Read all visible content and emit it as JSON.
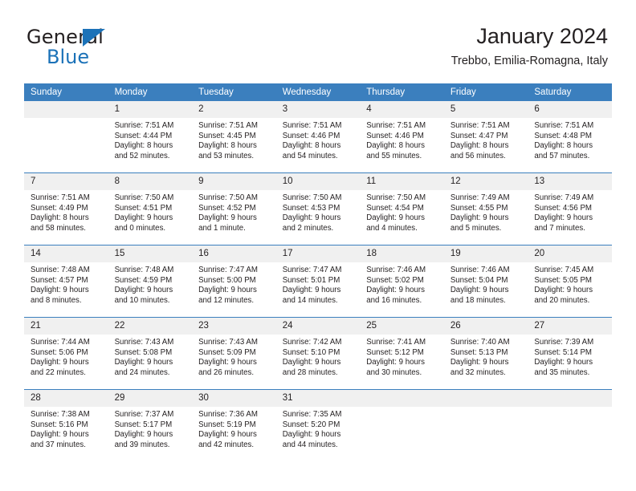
{
  "brand": {
    "name_top": "General",
    "name_bottom": "Blue",
    "accent_color": "#1b72b8"
  },
  "header": {
    "title": "January 2024",
    "subtitle": "Trebbo, Emilia-Romagna, Italy",
    "header_bg": "#3b7fbe",
    "daynum_bg": "#f0f0f0"
  },
  "weekdays": [
    "Sunday",
    "Monday",
    "Tuesday",
    "Wednesday",
    "Thursday",
    "Friday",
    "Saturday"
  ],
  "weeks": [
    [
      {
        "day": ""
      },
      {
        "day": "1",
        "sunrise": "Sunrise: 7:51 AM",
        "sunset": "Sunset: 4:44 PM",
        "daylight_1": "Daylight: 8 hours",
        "daylight_2": "and 52 minutes."
      },
      {
        "day": "2",
        "sunrise": "Sunrise: 7:51 AM",
        "sunset": "Sunset: 4:45 PM",
        "daylight_1": "Daylight: 8 hours",
        "daylight_2": "and 53 minutes."
      },
      {
        "day": "3",
        "sunrise": "Sunrise: 7:51 AM",
        "sunset": "Sunset: 4:46 PM",
        "daylight_1": "Daylight: 8 hours",
        "daylight_2": "and 54 minutes."
      },
      {
        "day": "4",
        "sunrise": "Sunrise: 7:51 AM",
        "sunset": "Sunset: 4:46 PM",
        "daylight_1": "Daylight: 8 hours",
        "daylight_2": "and 55 minutes."
      },
      {
        "day": "5",
        "sunrise": "Sunrise: 7:51 AM",
        "sunset": "Sunset: 4:47 PM",
        "daylight_1": "Daylight: 8 hours",
        "daylight_2": "and 56 minutes."
      },
      {
        "day": "6",
        "sunrise": "Sunrise: 7:51 AM",
        "sunset": "Sunset: 4:48 PM",
        "daylight_1": "Daylight: 8 hours",
        "daylight_2": "and 57 minutes."
      }
    ],
    [
      {
        "day": "7",
        "sunrise": "Sunrise: 7:51 AM",
        "sunset": "Sunset: 4:49 PM",
        "daylight_1": "Daylight: 8 hours",
        "daylight_2": "and 58 minutes."
      },
      {
        "day": "8",
        "sunrise": "Sunrise: 7:50 AM",
        "sunset": "Sunset: 4:51 PM",
        "daylight_1": "Daylight: 9 hours",
        "daylight_2": "and 0 minutes."
      },
      {
        "day": "9",
        "sunrise": "Sunrise: 7:50 AM",
        "sunset": "Sunset: 4:52 PM",
        "daylight_1": "Daylight: 9 hours",
        "daylight_2": "and 1 minute."
      },
      {
        "day": "10",
        "sunrise": "Sunrise: 7:50 AM",
        "sunset": "Sunset: 4:53 PM",
        "daylight_1": "Daylight: 9 hours",
        "daylight_2": "and 2 minutes."
      },
      {
        "day": "11",
        "sunrise": "Sunrise: 7:50 AM",
        "sunset": "Sunset: 4:54 PM",
        "daylight_1": "Daylight: 9 hours",
        "daylight_2": "and 4 minutes."
      },
      {
        "day": "12",
        "sunrise": "Sunrise: 7:49 AM",
        "sunset": "Sunset: 4:55 PM",
        "daylight_1": "Daylight: 9 hours",
        "daylight_2": "and 5 minutes."
      },
      {
        "day": "13",
        "sunrise": "Sunrise: 7:49 AM",
        "sunset": "Sunset: 4:56 PM",
        "daylight_1": "Daylight: 9 hours",
        "daylight_2": "and 7 minutes."
      }
    ],
    [
      {
        "day": "14",
        "sunrise": "Sunrise: 7:48 AM",
        "sunset": "Sunset: 4:57 PM",
        "daylight_1": "Daylight: 9 hours",
        "daylight_2": "and 8 minutes."
      },
      {
        "day": "15",
        "sunrise": "Sunrise: 7:48 AM",
        "sunset": "Sunset: 4:59 PM",
        "daylight_1": "Daylight: 9 hours",
        "daylight_2": "and 10 minutes."
      },
      {
        "day": "16",
        "sunrise": "Sunrise: 7:47 AM",
        "sunset": "Sunset: 5:00 PM",
        "daylight_1": "Daylight: 9 hours",
        "daylight_2": "and 12 minutes."
      },
      {
        "day": "17",
        "sunrise": "Sunrise: 7:47 AM",
        "sunset": "Sunset: 5:01 PM",
        "daylight_1": "Daylight: 9 hours",
        "daylight_2": "and 14 minutes."
      },
      {
        "day": "18",
        "sunrise": "Sunrise: 7:46 AM",
        "sunset": "Sunset: 5:02 PM",
        "daylight_1": "Daylight: 9 hours",
        "daylight_2": "and 16 minutes."
      },
      {
        "day": "19",
        "sunrise": "Sunrise: 7:46 AM",
        "sunset": "Sunset: 5:04 PM",
        "daylight_1": "Daylight: 9 hours",
        "daylight_2": "and 18 minutes."
      },
      {
        "day": "20",
        "sunrise": "Sunrise: 7:45 AM",
        "sunset": "Sunset: 5:05 PM",
        "daylight_1": "Daylight: 9 hours",
        "daylight_2": "and 20 minutes."
      }
    ],
    [
      {
        "day": "21",
        "sunrise": "Sunrise: 7:44 AM",
        "sunset": "Sunset: 5:06 PM",
        "daylight_1": "Daylight: 9 hours",
        "daylight_2": "and 22 minutes."
      },
      {
        "day": "22",
        "sunrise": "Sunrise: 7:43 AM",
        "sunset": "Sunset: 5:08 PM",
        "daylight_1": "Daylight: 9 hours",
        "daylight_2": "and 24 minutes."
      },
      {
        "day": "23",
        "sunrise": "Sunrise: 7:43 AM",
        "sunset": "Sunset: 5:09 PM",
        "daylight_1": "Daylight: 9 hours",
        "daylight_2": "and 26 minutes."
      },
      {
        "day": "24",
        "sunrise": "Sunrise: 7:42 AM",
        "sunset": "Sunset: 5:10 PM",
        "daylight_1": "Daylight: 9 hours",
        "daylight_2": "and 28 minutes."
      },
      {
        "day": "25",
        "sunrise": "Sunrise: 7:41 AM",
        "sunset": "Sunset: 5:12 PM",
        "daylight_1": "Daylight: 9 hours",
        "daylight_2": "and 30 minutes."
      },
      {
        "day": "26",
        "sunrise": "Sunrise: 7:40 AM",
        "sunset": "Sunset: 5:13 PM",
        "daylight_1": "Daylight: 9 hours",
        "daylight_2": "and 32 minutes."
      },
      {
        "day": "27",
        "sunrise": "Sunrise: 7:39 AM",
        "sunset": "Sunset: 5:14 PM",
        "daylight_1": "Daylight: 9 hours",
        "daylight_2": "and 35 minutes."
      }
    ],
    [
      {
        "day": "28",
        "sunrise": "Sunrise: 7:38 AM",
        "sunset": "Sunset: 5:16 PM",
        "daylight_1": "Daylight: 9 hours",
        "daylight_2": "and 37 minutes."
      },
      {
        "day": "29",
        "sunrise": "Sunrise: 7:37 AM",
        "sunset": "Sunset: 5:17 PM",
        "daylight_1": "Daylight: 9 hours",
        "daylight_2": "and 39 minutes."
      },
      {
        "day": "30",
        "sunrise": "Sunrise: 7:36 AM",
        "sunset": "Sunset: 5:19 PM",
        "daylight_1": "Daylight: 9 hours",
        "daylight_2": "and 42 minutes."
      },
      {
        "day": "31",
        "sunrise": "Sunrise: 7:35 AM",
        "sunset": "Sunset: 5:20 PM",
        "daylight_1": "Daylight: 9 hours",
        "daylight_2": "and 44 minutes."
      },
      {
        "day": ""
      },
      {
        "day": ""
      },
      {
        "day": ""
      }
    ]
  ]
}
